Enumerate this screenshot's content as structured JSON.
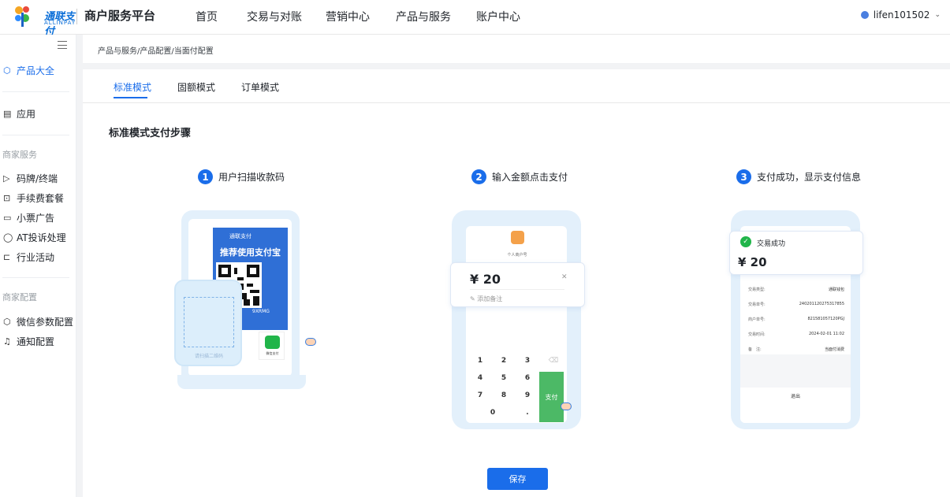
{
  "header": {
    "logo_text": "通联支付",
    "logo_sub": "ALLINPAY",
    "platform": "商户服务平台",
    "nav": [
      "首页",
      "交易与对账",
      "营销中心",
      "产品与服务",
      "账户中心"
    ],
    "user": "lifen101502"
  },
  "sidebar": {
    "items": [
      {
        "label": "产品大全",
        "icon": "cube-icon",
        "active": true
      },
      {
        "label": "应用",
        "icon": "app-box-icon"
      }
    ],
    "section1": "商家服务",
    "section1_items": [
      {
        "label": "码牌/终端",
        "icon": "terminal-icon"
      },
      {
        "label": "手续费套餐",
        "icon": "fee-icon"
      },
      {
        "label": "小票广告",
        "icon": "receipt-icon"
      },
      {
        "label": "AT投诉处理",
        "icon": "shield-icon"
      },
      {
        "label": "行业活动",
        "icon": "cart-icon"
      }
    ],
    "section2": "商家配置",
    "section2_items": [
      {
        "label": "微信参数配置",
        "icon": "cube-icon"
      },
      {
        "label": "通知配置",
        "icon": "bell-icon"
      }
    ]
  },
  "breadcrumb": "产品与服务/产品配置/当面付配置",
  "tabs": [
    {
      "label": "标准模式",
      "active": true
    },
    {
      "label": "固额模式"
    },
    {
      "label": "订单模式"
    }
  ],
  "section_title": "标准模式支付步骤",
  "steps": [
    {
      "num": "1",
      "label": "用户扫描收款码"
    },
    {
      "num": "2",
      "label": "输入金额点击支付"
    },
    {
      "num": "3",
      "label": "支付成功，显示支付信息"
    }
  ],
  "phone1": {
    "brand": "通联支付",
    "title": "推荐使用支付宝",
    "code": "9XRMG",
    "wechat": "微信支付",
    "scan_hint": "请扫描二维码"
  },
  "phone2": {
    "account": "个人商户号",
    "amount": "¥ 20",
    "note": "添加备注",
    "keys": [
      "1",
      "2",
      "3",
      "4",
      "5",
      "6",
      "7",
      "8",
      "9",
      "0",
      "."
    ],
    "pay": "支付"
  },
  "phone3": {
    "status": "交易成功",
    "amount": "¥ 20",
    "rows": [
      {
        "k": "交易类型:",
        "v": "通联钱包"
      },
      {
        "k": "交易单号:",
        "v": "240201120275317855"
      },
      {
        "k": "商户单号:",
        "v": "821581057120PGJ"
      },
      {
        "k": "交易时间:",
        "v": "2024-02-01 11:02"
      },
      {
        "k": "备　注:",
        "v": "当面付消费"
      }
    ],
    "exit": "退出"
  },
  "save_label": "保存",
  "colors": {
    "accent": "#1a6dea",
    "success": "#21b54a"
  }
}
